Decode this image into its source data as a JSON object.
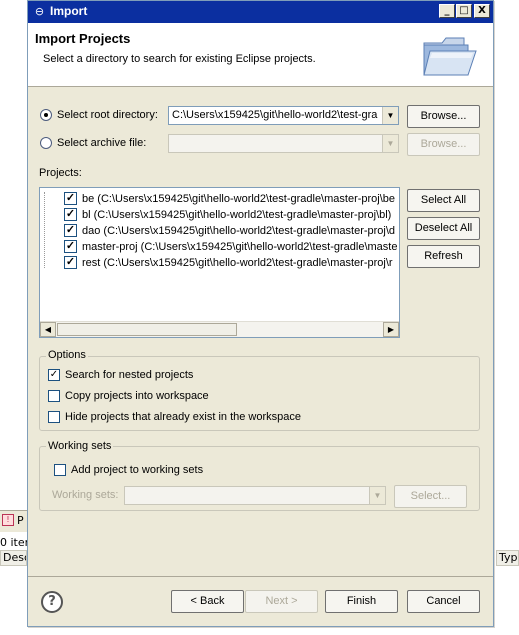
{
  "background": {
    "tab_label": "P",
    "items_label": "0 item",
    "col_left": "Desc",
    "col_right": "Typ"
  },
  "dialog": {
    "title": "Import",
    "window_buttons": {
      "minimize": "_",
      "maximize": "□",
      "close": "X"
    },
    "header": {
      "title": "Import Projects",
      "description": "Select a directory to search for existing Eclipse projects."
    },
    "root_directory": {
      "label": "Select root directory:",
      "value": "C:\\Users\\x159425\\git\\hello-world2\\test-gra",
      "browse": "Browse...",
      "selected": true
    },
    "archive_file": {
      "label": "Select archive file:",
      "value": "",
      "browse": "Browse...",
      "selected": false
    },
    "projects_label": "Projects:",
    "projects": [
      {
        "text": "be (C:\\Users\\x159425\\git\\hello-world2\\test-gradle\\master-proj\\be",
        "checked": true
      },
      {
        "text": "bl (C:\\Users\\x159425\\git\\hello-world2\\test-gradle\\master-proj\\bl)",
        "checked": true
      },
      {
        "text": "dao (C:\\Users\\x159425\\git\\hello-world2\\test-gradle\\master-proj\\d",
        "checked": true
      },
      {
        "text": "master-proj (C:\\Users\\x159425\\git\\hello-world2\\test-gradle\\maste",
        "checked": true
      },
      {
        "text": "rest (C:\\Users\\x159425\\git\\hello-world2\\test-gradle\\master-proj\\r",
        "checked": true
      }
    ],
    "select_all": "Select All",
    "deselect_all": "Deselect All",
    "refresh": "Refresh",
    "options": {
      "title": "Options",
      "nested": {
        "label": "Search for nested projects",
        "checked": true
      },
      "copy": {
        "label": "Copy projects into workspace",
        "checked": false
      },
      "hide": {
        "label": "Hide projects that already exist in the workspace",
        "checked": false
      }
    },
    "working_sets": {
      "title": "Working sets",
      "add": {
        "label": "Add project to working sets",
        "checked": false
      },
      "sets_label": "Working sets:",
      "select": "Select..."
    },
    "footer": {
      "help": "?",
      "back": "< Back",
      "next": "Next >",
      "finish": "Finish",
      "cancel": "Cancel"
    }
  }
}
